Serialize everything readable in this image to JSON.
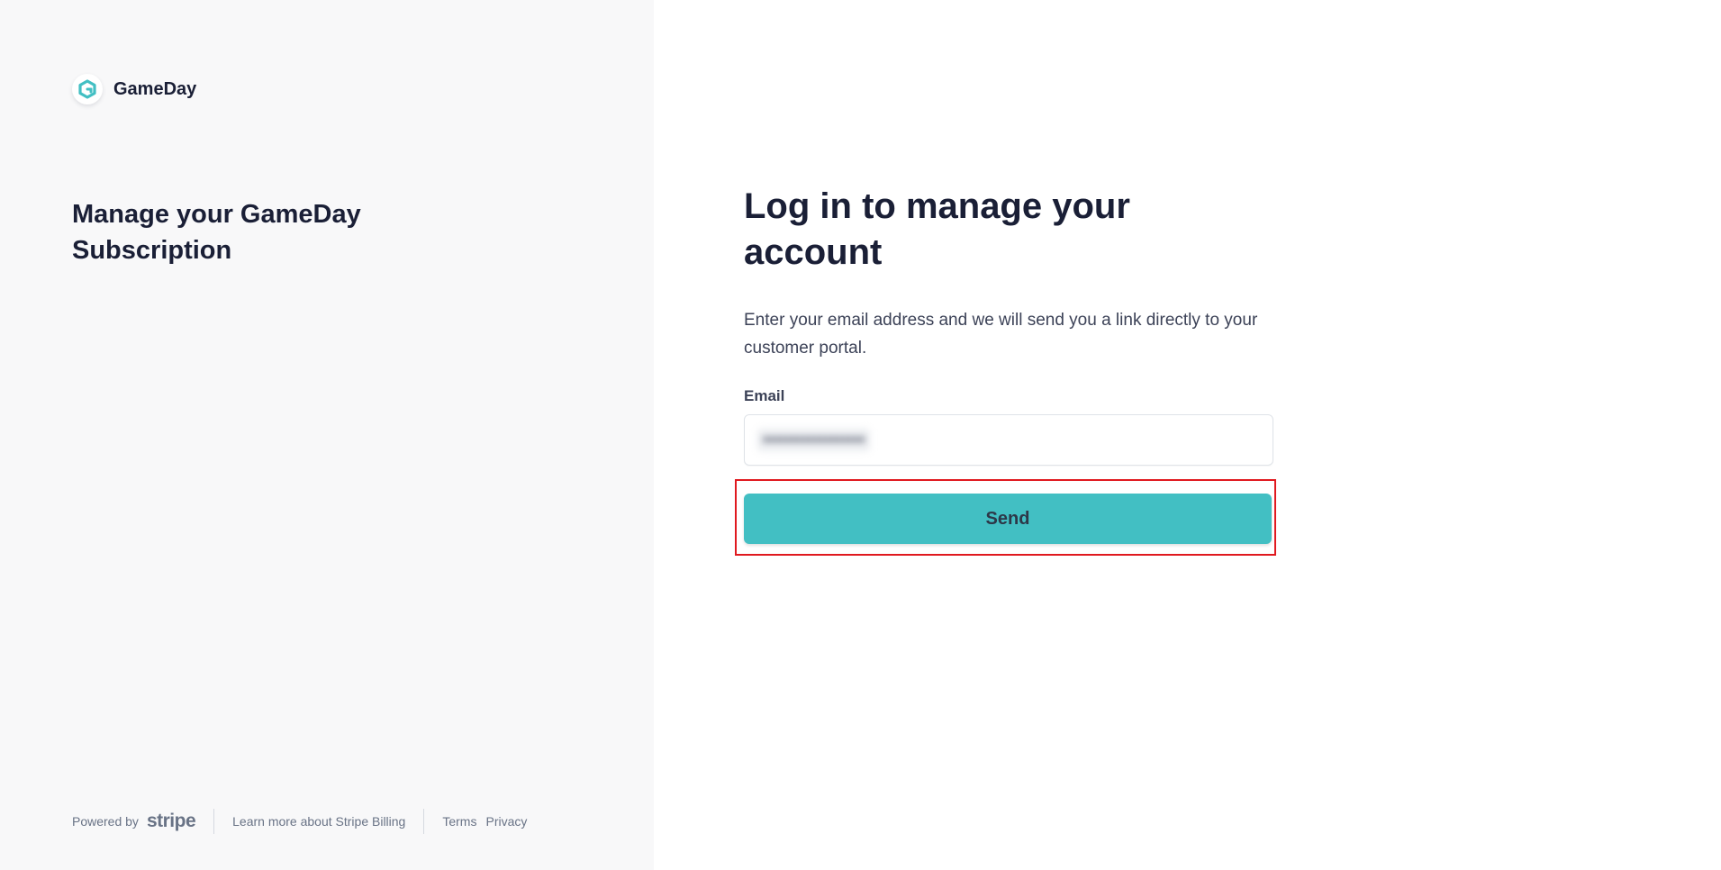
{
  "brand": {
    "name": "GameDay",
    "logo_icon": "gameday-g-logo",
    "accent_color": "#42bfc3"
  },
  "left": {
    "title": "Manage your GameDay Subscription"
  },
  "footer": {
    "powered_by": "Powered by",
    "stripe": "stripe",
    "learn_more": "Learn more about Stripe Billing",
    "terms": "Terms",
    "privacy": "Privacy"
  },
  "main": {
    "title": "Log in to manage your account",
    "description": "Enter your email address and we will send you a link directly to your customer portal.",
    "email_label": "Email",
    "email_value": "••••••••••••••••••",
    "send_label": "Send"
  },
  "colors": {
    "left_panel_bg": "#f8f8f9",
    "button_bg": "#42bfc3",
    "highlight_border": "#e0191f",
    "text_primary": "#1a1f36"
  }
}
